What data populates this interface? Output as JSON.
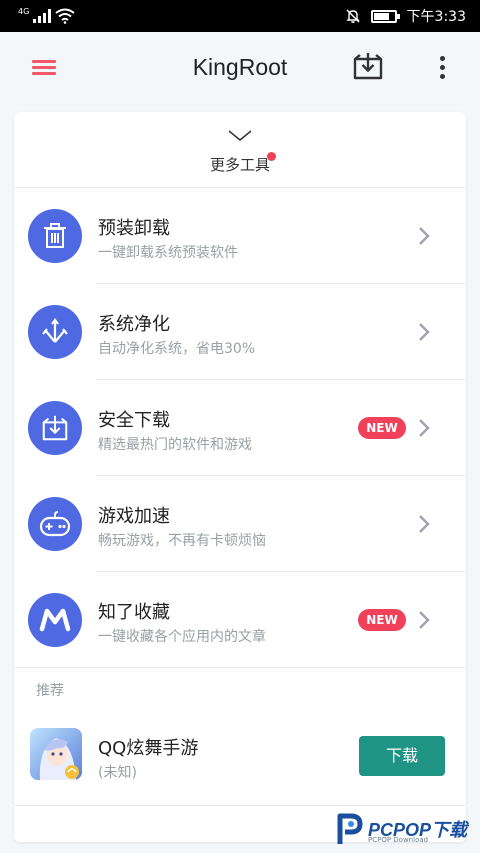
{
  "status_bar": {
    "network": "4G",
    "time": "下午3:33"
  },
  "app_bar": {
    "title": "KingRoot"
  },
  "more_tools": {
    "label": "更多工具"
  },
  "tools": [
    {
      "title": "预装卸载",
      "subtitle": "一键卸载系统预装软件",
      "icon": "trash-icon",
      "badge": ""
    },
    {
      "title": "系统净化",
      "subtitle": "自动净化系统，省电30%",
      "icon": "trident-icon",
      "badge": ""
    },
    {
      "title": "安全下载",
      "subtitle": "精选最热门的软件和游戏",
      "icon": "download-box-icon",
      "badge": "NEW"
    },
    {
      "title": "游戏加速",
      "subtitle": "畅玩游戏，不再有卡顿烦恼",
      "icon": "gamepad-icon",
      "badge": ""
    },
    {
      "title": "知了收藏",
      "subtitle": "一键收藏各个应用内的文章",
      "icon": "m-logo-icon",
      "badge": "NEW"
    }
  ],
  "recommend": {
    "label": "推荐",
    "app": {
      "title": "QQ炫舞手游",
      "subtitle": "(未知)",
      "button": "下载"
    }
  },
  "watermark": {
    "brand": "PCPOP下载",
    "sub": "PCPOP Download"
  },
  "colors": {
    "accent": "#4e69e2",
    "badge": "#f0415a",
    "install": "#1f9485",
    "menu": "#f05a6a"
  }
}
